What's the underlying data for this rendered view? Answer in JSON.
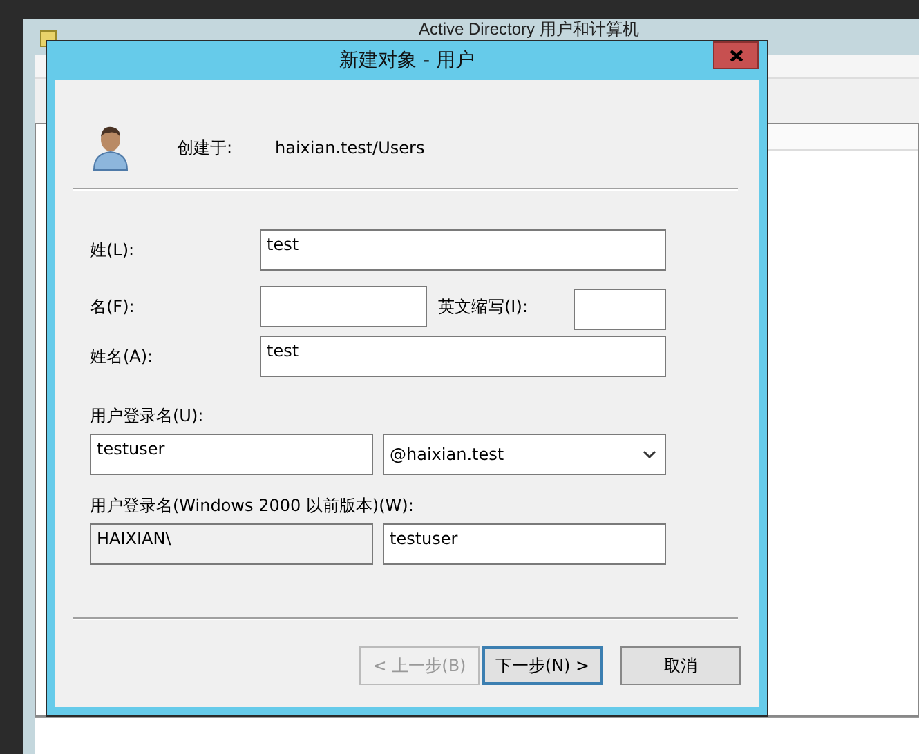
{
  "background_window": {
    "title": "Active Directory 用户和计算机"
  },
  "dialog": {
    "title": "新建对象 - 用户",
    "created_in_label": "创建于:",
    "created_in": "haixian.test/Users"
  },
  "last_name": {
    "label": "姓(L):",
    "value": "test"
  },
  "first_name": {
    "label": "名(F):"
  },
  "initials": {
    "label": "英文缩写(I):"
  },
  "full_name": {
    "label": "姓名(A):",
    "value": "test"
  },
  "logon": {
    "label": "用户登录名(U):",
    "value": "testuser",
    "domain": "@haixian.test"
  },
  "logon_pre2000": {
    "label": "用户登录名(Windows 2000 以前版本)(W):",
    "domain": "HAIXIAN\\",
    "value": "testuser"
  },
  "buttons": [
    {
      "label": "< 上一步(B)",
      "disabled": true,
      "default": false
    },
    {
      "label": "下一步(N) >",
      "disabled": false,
      "default": true
    },
    {
      "label": "取消",
      "disabled": false,
      "default": false
    }
  ]
}
